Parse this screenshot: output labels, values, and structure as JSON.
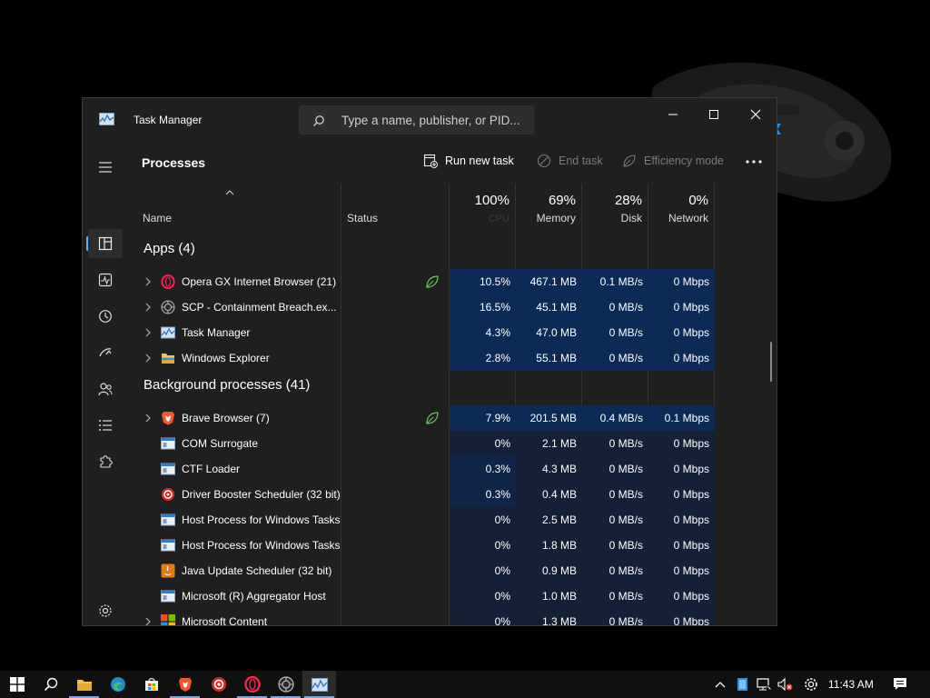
{
  "window": {
    "title": "Task Manager",
    "search_placeholder": "Type a name, publisher, or PID..."
  },
  "commandbar": {
    "page_title": "Processes",
    "run_new_task": "Run new task",
    "end_task": "End task",
    "efficiency_mode": "Efficiency mode"
  },
  "columns": {
    "name": "Name",
    "status": "Status",
    "cpu_pct": "100%",
    "cpu_label": "CPU",
    "memory_pct": "69%",
    "memory_label": "Memory",
    "disk_pct": "28%",
    "disk_label": "Disk",
    "network_pct": "0%",
    "network_label": "Network"
  },
  "groups": {
    "apps": "Apps (4)",
    "background": "Background processes (41)"
  },
  "apps": [
    {
      "name": "Opera GX Internet Browser (21)",
      "cpu": "10.5%",
      "memory": "467.1 MB",
      "disk": "0.1 MB/s",
      "network": "0 Mbps",
      "icon": "opera-gx-icon",
      "efficiency": true
    },
    {
      "name": "SCP - Containment Breach.ex...",
      "cpu": "16.5%",
      "memory": "45.1 MB",
      "disk": "0 MB/s",
      "network": "0 Mbps",
      "icon": "scp-icon",
      "efficiency": false
    },
    {
      "name": "Task Manager",
      "cpu": "4.3%",
      "memory": "47.0 MB",
      "disk": "0 MB/s",
      "network": "0 Mbps",
      "icon": "task-manager-icon",
      "efficiency": false
    },
    {
      "name": "Windows Explorer",
      "cpu": "2.8%",
      "memory": "55.1 MB",
      "disk": "0 MB/s",
      "network": "0 Mbps",
      "icon": "folder-icon",
      "efficiency": false
    }
  ],
  "background": [
    {
      "name": "Brave Browser (7)",
      "cpu": "7.9%",
      "memory": "201.5 MB",
      "disk": "0.4 MB/s",
      "network": "0.1 Mbps",
      "icon": "brave-icon",
      "expandable": true,
      "efficiency": true
    },
    {
      "name": "COM Surrogate",
      "cpu": "0%",
      "memory": "2.1 MB",
      "disk": "0 MB/s",
      "network": "0 Mbps",
      "icon": "generic-window-icon",
      "expandable": false
    },
    {
      "name": "CTF Loader",
      "cpu": "0.3%",
      "memory": "4.3 MB",
      "disk": "0 MB/s",
      "network": "0 Mbps",
      "icon": "generic-window-icon",
      "expandable": false
    },
    {
      "name": "Driver Booster Scheduler (32 bit)",
      "cpu": "0.3%",
      "memory": "0.4 MB",
      "disk": "0 MB/s",
      "network": "0 Mbps",
      "icon": "driver-booster-icon",
      "expandable": false
    },
    {
      "name": "Host Process for Windows Tasks",
      "cpu": "0%",
      "memory": "2.5 MB",
      "disk": "0 MB/s",
      "network": "0 Mbps",
      "icon": "generic-window-icon",
      "expandable": false
    },
    {
      "name": "Host Process for Windows Tasks",
      "cpu": "0%",
      "memory": "1.8 MB",
      "disk": "0 MB/s",
      "network": "0 Mbps",
      "icon": "generic-window-icon",
      "expandable": false
    },
    {
      "name": "Java Update Scheduler (32 bit)",
      "cpu": "0%",
      "memory": "0.9 MB",
      "disk": "0 MB/s",
      "network": "0 Mbps",
      "icon": "java-icon",
      "expandable": false
    },
    {
      "name": "Microsoft (R) Aggregator Host",
      "cpu": "0%",
      "memory": "1.0 MB",
      "disk": "0 MB/s",
      "network": "0 Mbps",
      "icon": "generic-window-icon",
      "expandable": false
    },
    {
      "name": "Microsoft Content",
      "cpu": "0%",
      "memory": "1.3 MB",
      "disk": "0 MB/s",
      "network": "0 Mbps",
      "icon": "microsoft-logo-icon",
      "expandable": true
    }
  ],
  "taskbar": {
    "clock": "11:43 AM"
  },
  "colors": {
    "accent": "#5db1ff",
    "highlight_strong": "#0d2a57",
    "highlight_light": "#132036",
    "efficiency_leaf": "#6ccb5f"
  }
}
